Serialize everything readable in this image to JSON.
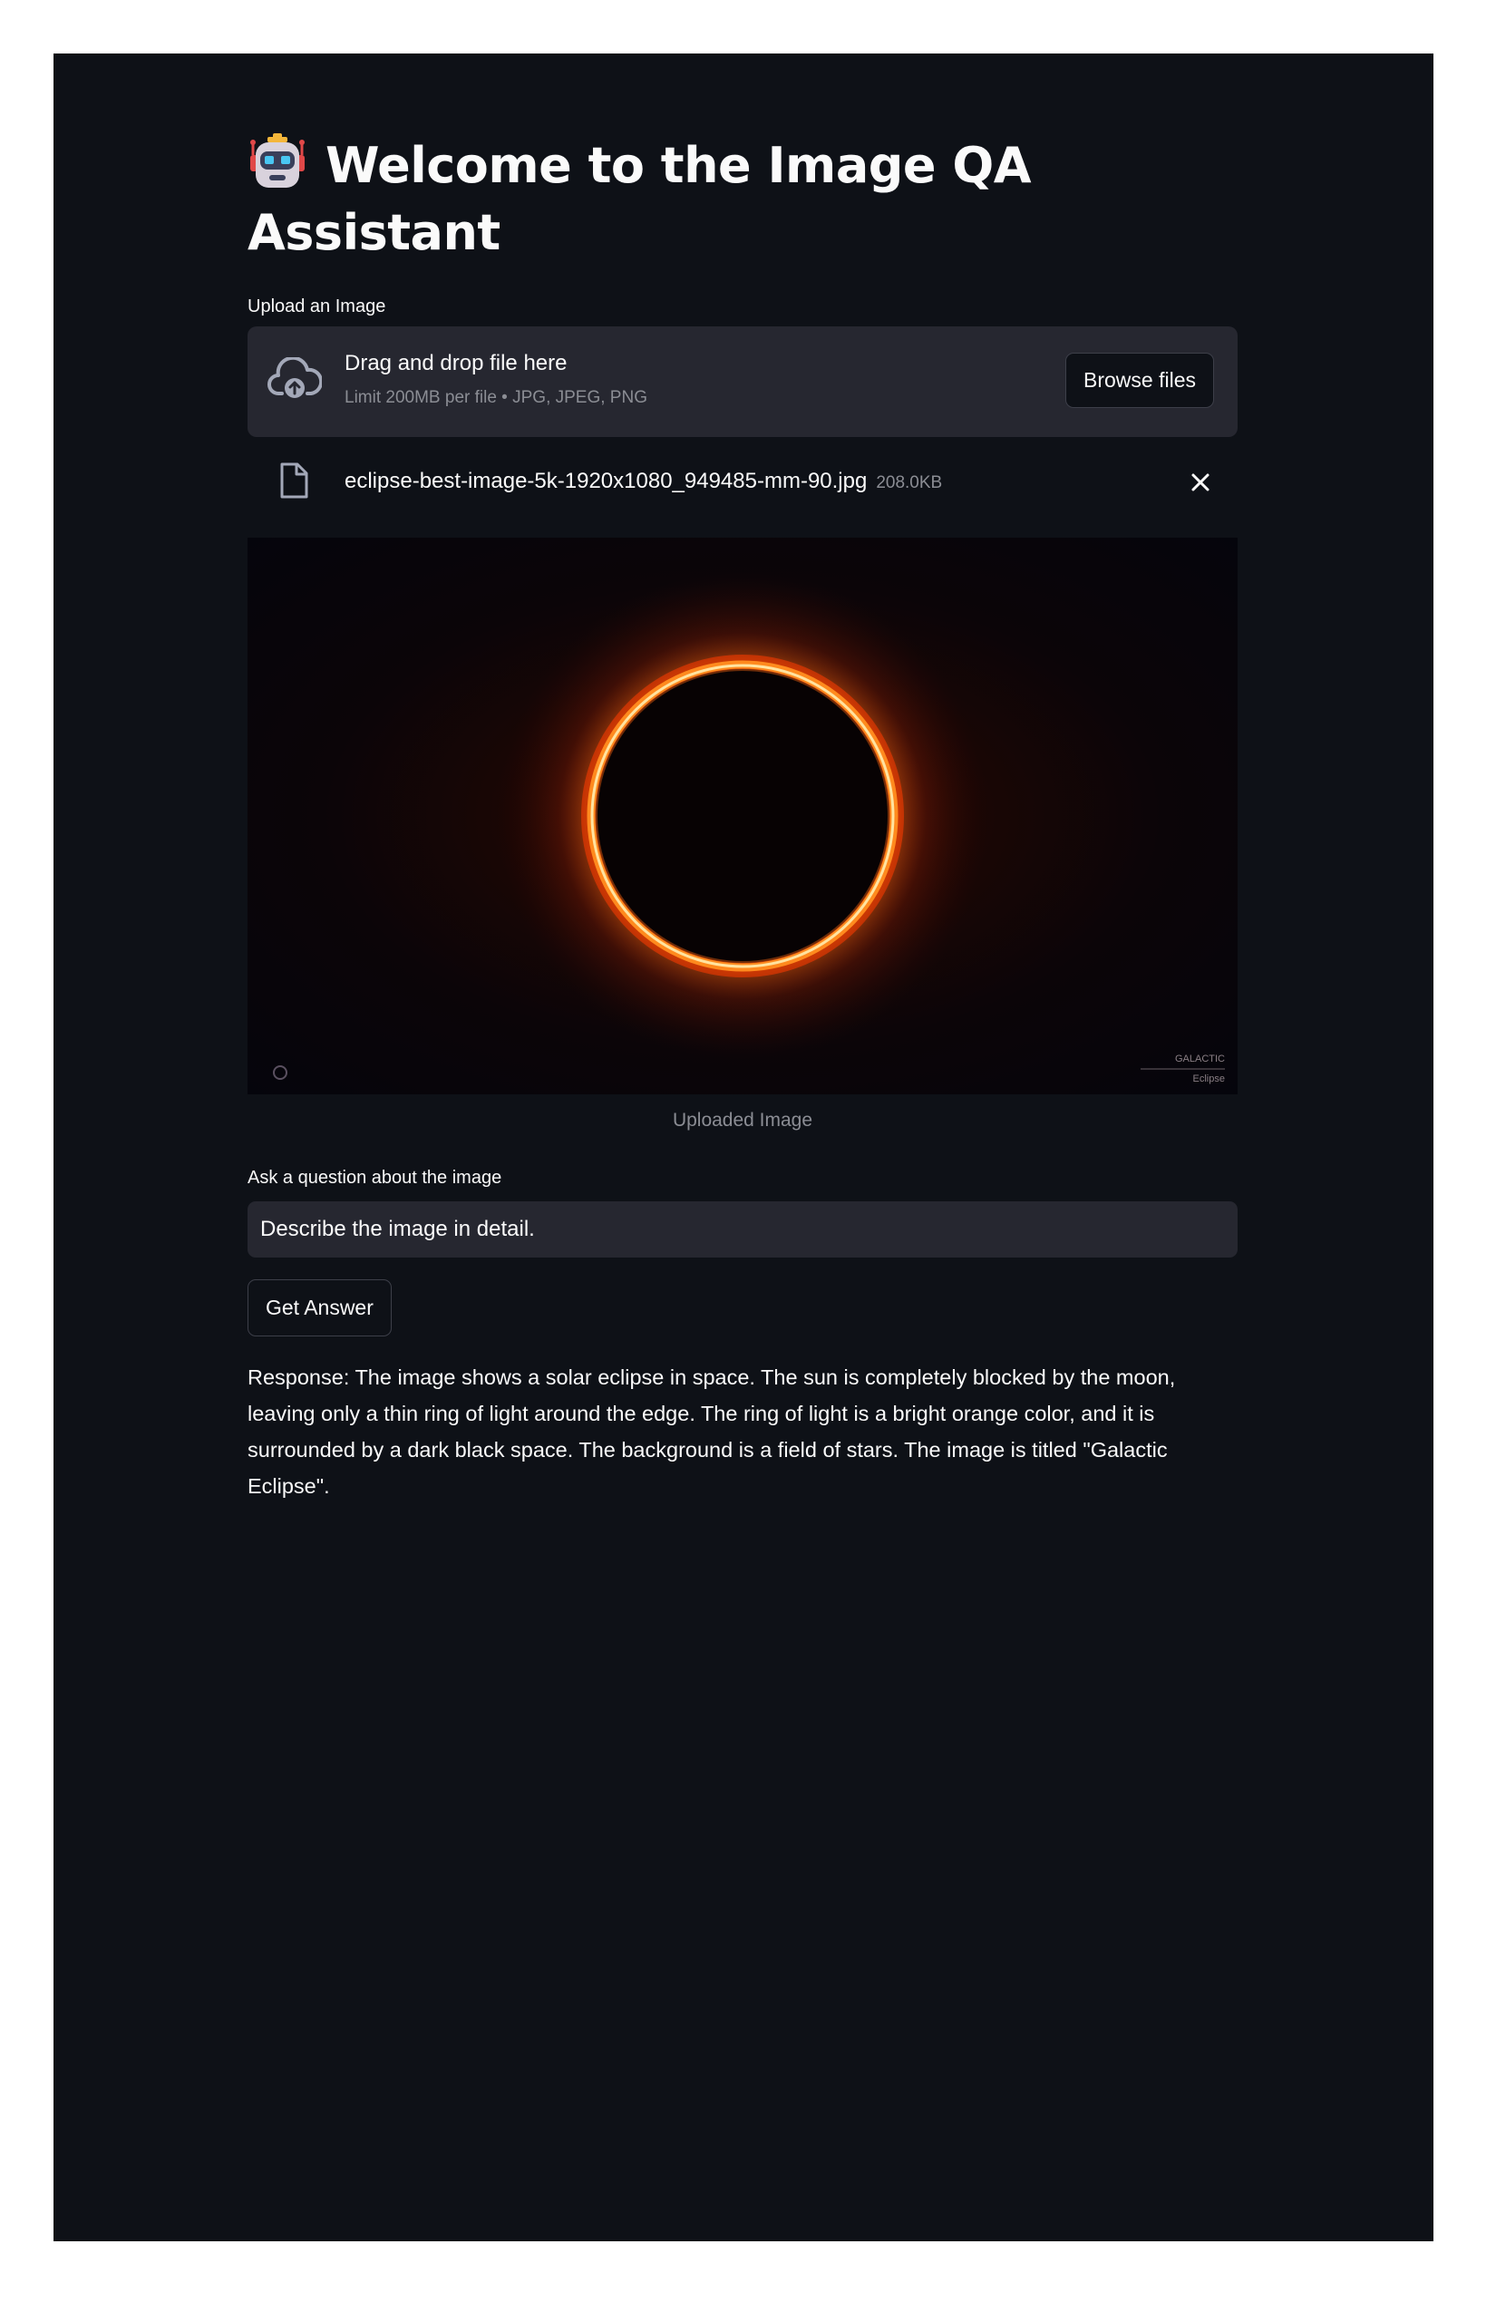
{
  "header": {
    "icon": "robot-face-icon",
    "title": "Welcome to the Image QA Assistant"
  },
  "uploader": {
    "label": "Upload an Image",
    "dropzone_text": "Drag and drop file here",
    "limit_text": "Limit 200MB per file • JPG, JPEG, PNG",
    "browse_label": "Browse files",
    "upload_icon": "cloud-upload-icon"
  },
  "uploaded_file": {
    "icon": "file-icon",
    "name": "eclipse-best-image-5k-1920x1080_949485-mm-90.jpg",
    "size": "208.0KB",
    "remove_icon": "close-icon"
  },
  "image": {
    "caption": "Uploaded Image",
    "watermark_line1": "GALACTIC",
    "watermark_line2": "Eclipse"
  },
  "question": {
    "label": "Ask a question about the image",
    "value": "Describe the image in detail."
  },
  "submit": {
    "label": "Get Answer"
  },
  "response": {
    "text": "Response: The image shows a solar eclipse in space. The sun is completely blocked by the moon, leaving only a thin ring of light around the edge. The ring of light is a bright orange color, and it is surrounded by a dark black space. The background is a field of stars. The image is titled \"Galactic Eclipse\"."
  },
  "colors": {
    "background": "#0e1117",
    "widget_bg": "#262730",
    "text": "#fafafa",
    "muted_text": "#8b8d94",
    "eclipse_ring": "#ff8a1e"
  }
}
